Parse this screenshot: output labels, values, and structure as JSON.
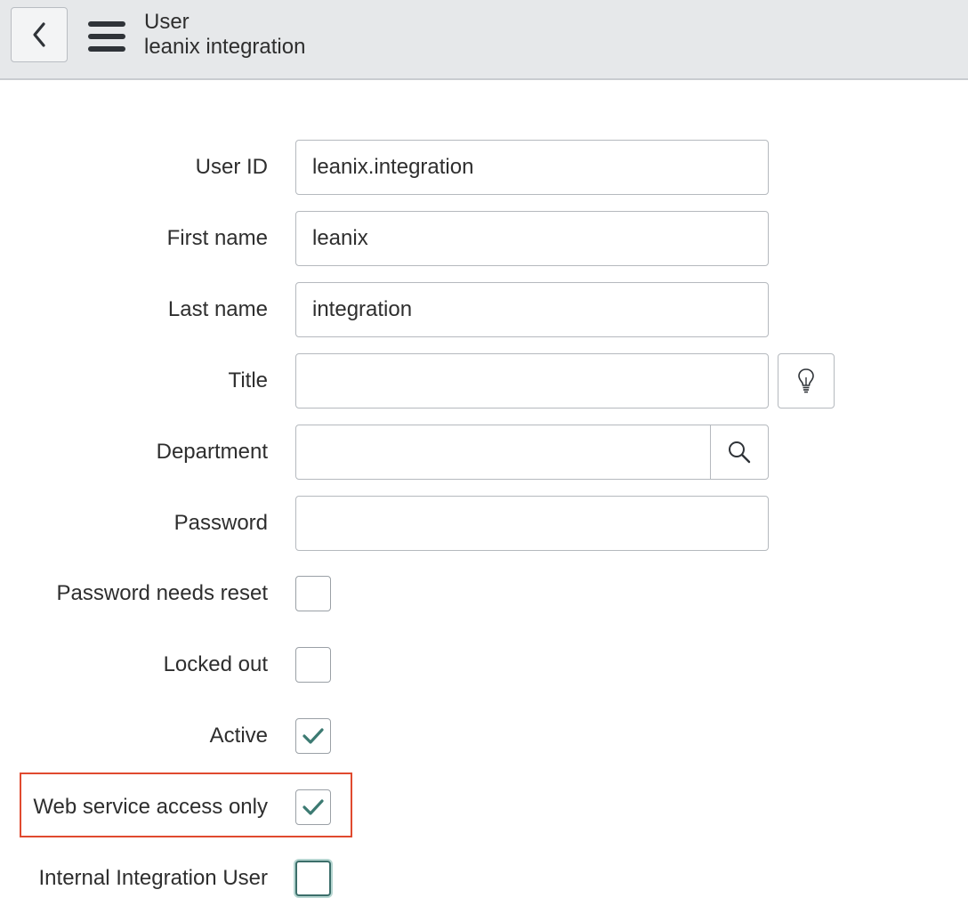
{
  "header": {
    "title": "User",
    "subtitle": "leanix integration"
  },
  "form": {
    "user_id": {
      "label": "User ID",
      "value": "leanix.integration"
    },
    "first_name": {
      "label": "First name",
      "value": "leanix"
    },
    "last_name": {
      "label": "Last name",
      "value": "integration"
    },
    "title": {
      "label": "Title",
      "value": ""
    },
    "department": {
      "label": "Department",
      "value": ""
    },
    "password": {
      "label": "Password",
      "value": ""
    },
    "password_needs_reset": {
      "label": "Password needs reset",
      "checked": false
    },
    "locked_out": {
      "label": "Locked out",
      "checked": false
    },
    "active": {
      "label": "Active",
      "checked": true
    },
    "web_service_access_only": {
      "label": "Web service access only",
      "checked": true
    },
    "internal_integration_user": {
      "label": "Internal Integration User",
      "checked": false
    }
  },
  "colors": {
    "check": "#3c7a72",
    "highlight_border": "#e04a2f",
    "header_bg": "#e6e8ea"
  }
}
